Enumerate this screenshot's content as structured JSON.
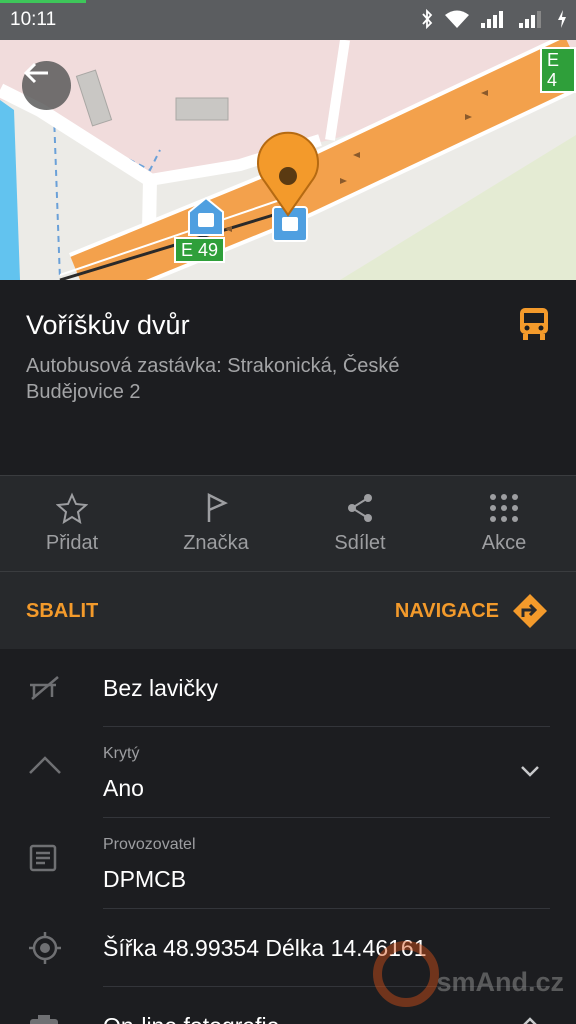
{
  "status_bar": {
    "time": "10:11"
  },
  "map": {
    "road_labels": [
      "E 49",
      "E 4"
    ]
  },
  "place": {
    "title": "Voříškův dvůr",
    "subtitle": "Autobusová zastávka: Strakonická, České Budějovice 2"
  },
  "actions": [
    {
      "label": "Přidat",
      "icon": "star-icon"
    },
    {
      "label": "Značka",
      "icon": "flag-icon"
    },
    {
      "label": "Sdílet",
      "icon": "share-icon"
    },
    {
      "label": "Akce",
      "icon": "grid-dots-icon"
    }
  ],
  "navrow": {
    "collapse_label": "SBALIT",
    "navigate_label": "NAVIGACE"
  },
  "details": {
    "bench": {
      "value": "Bez lavičky"
    },
    "covered": {
      "label": "Krytý",
      "value": "Ano"
    },
    "operator": {
      "label": "Provozovatel",
      "value": "DPMCB"
    },
    "coords": {
      "value": "Šířka 48.99354 Délka 14.46161"
    },
    "photos": {
      "value": "On-line fotografie"
    }
  },
  "watermark": "smAnd.cz",
  "colors": {
    "accent": "#f39a2b",
    "panel": "#1c1d20",
    "bar": "#27292c",
    "road": "#f3a14c"
  }
}
